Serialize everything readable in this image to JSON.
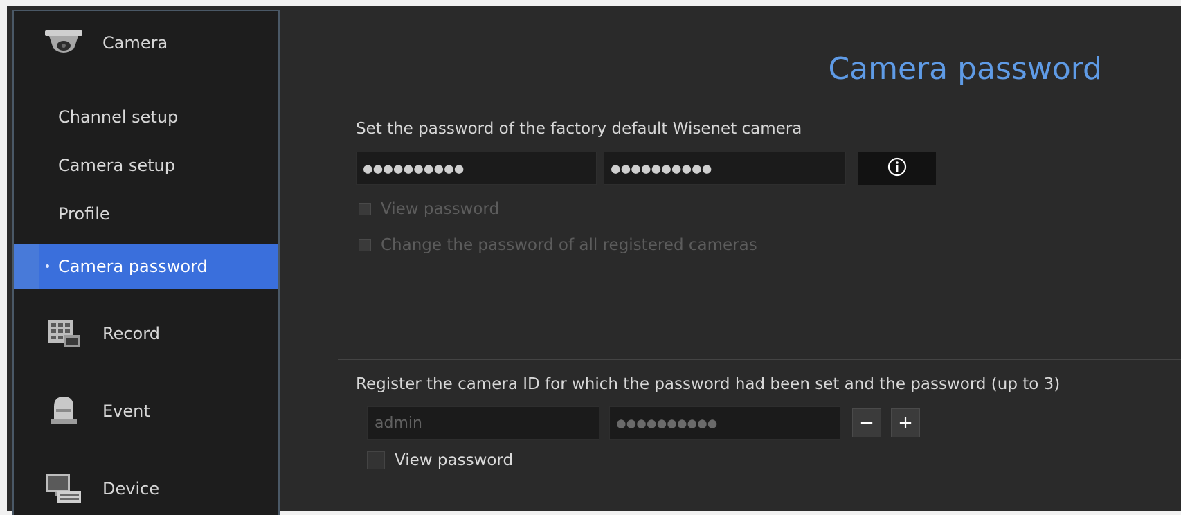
{
  "sidebar": {
    "categories": [
      {
        "label": "Camera",
        "icon": "dome-camera-icon"
      },
      {
        "label": "Record",
        "icon": "record-schedule-icon"
      },
      {
        "label": "Event",
        "icon": "event-alarm-icon"
      },
      {
        "label": "Device",
        "icon": "device-monitor-icon"
      }
    ],
    "camera_items": [
      {
        "label": "Channel setup"
      },
      {
        "label": "Camera setup"
      },
      {
        "label": "Profile"
      },
      {
        "label": "Camera password",
        "active": true
      }
    ]
  },
  "main": {
    "title": "Camera password",
    "factory": {
      "label": "Set the password of the factory default Wisenet camera",
      "password_value": "●●●●●●●●●●",
      "confirm_value": "●●●●●●●●●●",
      "view_password_label": "View password",
      "change_all_label": "Change the password of all registered cameras"
    },
    "register": {
      "label": "Register the camera ID for which the password had been set and the password (up to 3)",
      "id_placeholder": "admin",
      "password_value": "●●●●●●●●●●",
      "minus_label": "−",
      "plus_label": "+",
      "view_password_label": "View password"
    }
  },
  "colors": {
    "accent": "#3a6fdc",
    "title": "#5f9be6",
    "background": "#2a2a2a",
    "sidebar": "#1d1d1d"
  }
}
